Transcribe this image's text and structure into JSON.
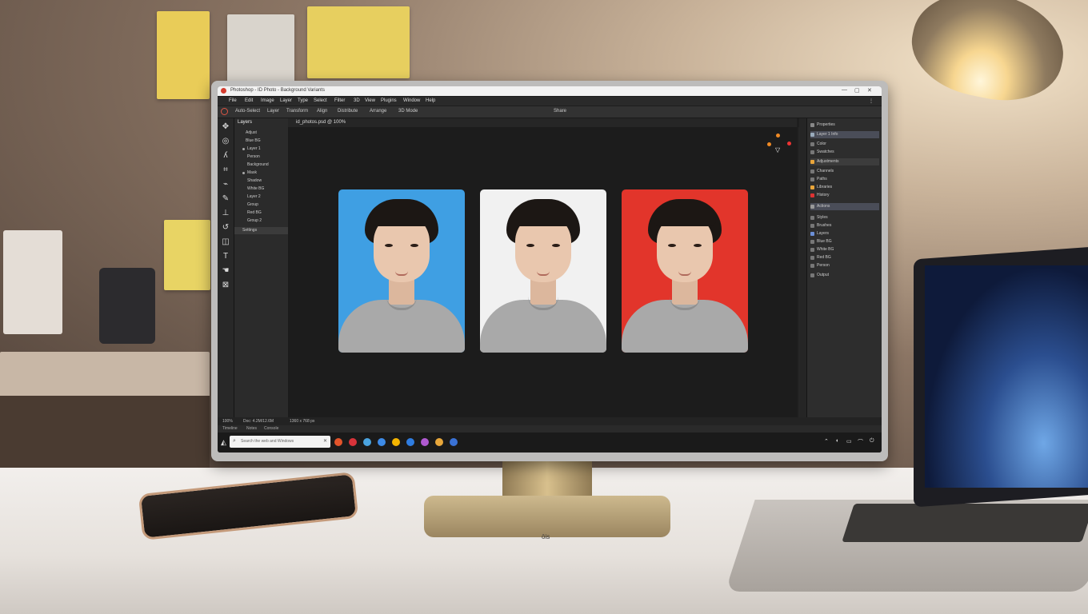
{
  "app": {
    "title": "Photoshop - ID Photo - Background Variants",
    "window_controls": [
      "—",
      "▢",
      "✕"
    ]
  },
  "menu": [
    "File",
    "Edit",
    "Image",
    "Layer",
    "Type",
    "Select",
    "Filter",
    "3D",
    "View",
    "Plugins",
    "Window",
    "Help"
  ],
  "options": [
    "Auto-Select",
    "Layer",
    "Transform",
    "Align",
    "Distribute",
    "Arrange",
    "3D Mode",
    "Share"
  ],
  "doc_tab": "id_photos.psd @ 100%",
  "layers_panel": {
    "header": "Layers",
    "rows": [
      "Adjust",
      "Blue BG",
      "Layer 1",
      "Person",
      "Background",
      "Mask",
      "Shadow",
      "White BG",
      "Layer 2",
      "Group",
      "Red BG",
      "Group 2",
      "Settings"
    ]
  },
  "right_panel": {
    "rows": [
      "Properties",
      "Layer 1 Info",
      "Color",
      "Swatches",
      "Adjustments",
      "Channels",
      "Paths",
      "Libraries",
      "History",
      "Actions",
      "Styles",
      "Brushes",
      "Layers",
      "Blue BG",
      "White BG",
      "Red BG",
      "Person",
      "Output"
    ],
    "selected": [
      1,
      9
    ]
  },
  "photos": [
    {
      "label": "Blue background",
      "bg": "#3f9fe3"
    },
    {
      "label": "White background",
      "bg": "#f1f1f1"
    },
    {
      "label": "Red background",
      "bg": "#e2352b"
    }
  ],
  "status": [
    "100%",
    "Doc: 4.2M/12.6M",
    "1360 x 768 px"
  ],
  "subbar": [
    "Timeline",
    "Notes",
    "Console"
  ],
  "taskbar": {
    "search_placeholder": "Search the web and Windows",
    "apps": [
      "#e2542b",
      "#d8333a",
      "#4aa3e0",
      "#3d8be8",
      "#f4b400",
      "#2f7de1",
      "#b05ad1",
      "#e8a73b",
      "#3a72d6"
    ]
  },
  "monitor_brand": "ōis"
}
